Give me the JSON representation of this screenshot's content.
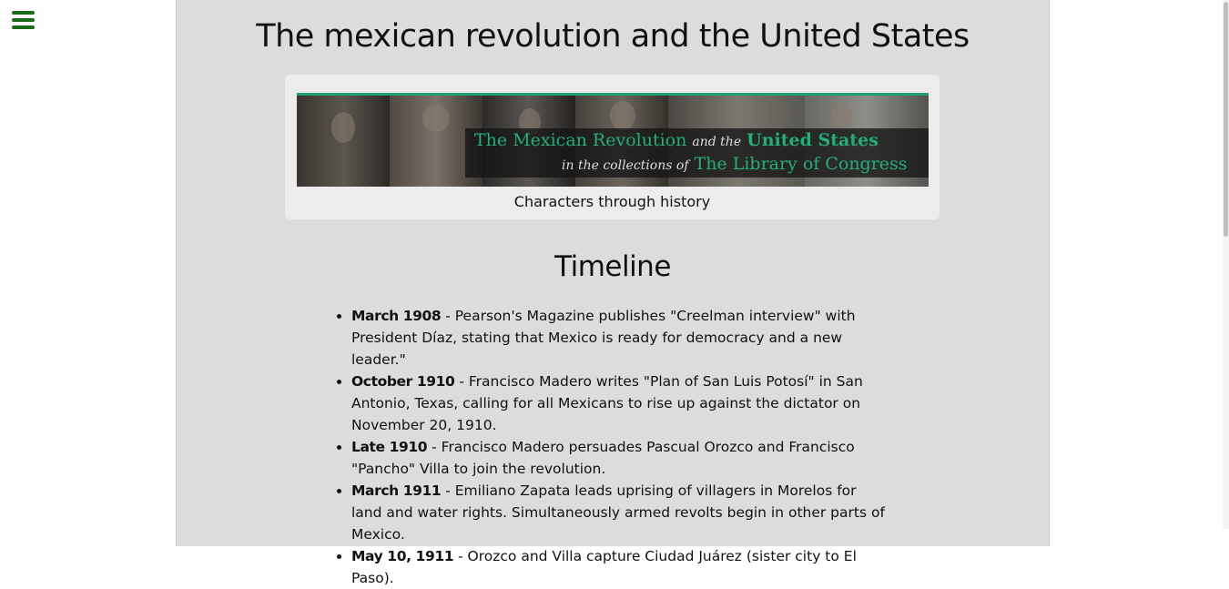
{
  "nav": {
    "menu_icon": "hamburger-menu-icon"
  },
  "page": {
    "title": "The mexican revolution and the United States"
  },
  "banner": {
    "line1_part1": "The Mexican Revolution",
    "line1_part2": "and the",
    "line1_part3": "United States",
    "line2_part1": "in the collections of",
    "line2_part2": "The Library of Congress",
    "caption": "Characters through history"
  },
  "timeline": {
    "title": "Timeline",
    "items": [
      {
        "date": "March 1908",
        "text": " - Pearson's Magazine publishes \"Creelman interview\" with President Díaz, stating that Mexico is ready for democracy and a new leader.\""
      },
      {
        "date": "October 1910",
        "text": " - Francisco Madero writes \"Plan of San Luis Potosí\" in San Antonio, Texas, calling for all Mexicans to rise up against the dictator on November 20, 1910."
      },
      {
        "date": "Late 1910",
        "text": " - Francisco Madero persuades Pascual Orozco and Francisco \"Pancho\" Villa to join the revolution."
      },
      {
        "date": "March 1911",
        "text": " - Emiliano Zapata leads uprising of villagers in Morelos for land and water rights. Simultaneously armed revolts begin in other parts of Mexico."
      },
      {
        "date": "May 10, 1911",
        "text": " - Orozco and Villa capture Ciudad Juárez (sister city to El Paso)."
      }
    ]
  },
  "colors": {
    "accent": "#22b07a",
    "menu": "#1a6b1a",
    "content_bg": "#dcdcdc"
  }
}
